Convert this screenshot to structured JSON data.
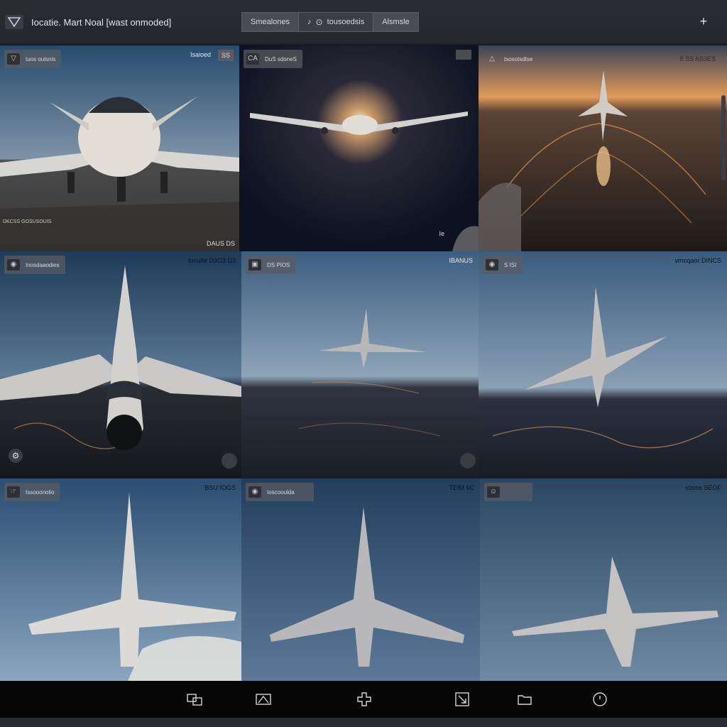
{
  "window": {
    "title": "Iocatie. Mart Noal [wast onmoded]",
    "new_tab_icon": "plus-icon",
    "logo_icon": "triangle-logo-icon"
  },
  "toolbar_tabs": [
    {
      "label": "Smealones"
    },
    {
      "label": "tousoedsis"
    },
    {
      "label": "Alsmsle"
    }
  ],
  "tiles": [
    {
      "chip_label": "tuos oulsnis",
      "tag": "Isaioed",
      "corner": "DAUS DS",
      "footnote": "DKCSS GOSUSOUIS"
    },
    {
      "chip_label": "DuS sdoneS",
      "tag": "",
      "corner": "Ie",
      "footnote": ""
    },
    {
      "chip_label": "tsosotsdtse",
      "tag": "9 SS AS3ES",
      "corner": "",
      "footnote": ""
    },
    {
      "chip_label": "Inosdaaodies",
      "tag": "Ionufle D3G3 D3",
      "corner": "",
      "footnote": ""
    },
    {
      "chip_label": "DS PIOS",
      "tag": "IBANUS",
      "corner": "",
      "footnote": ""
    },
    {
      "chip_label": "S ISI",
      "tag": "vmoqaor DINCS",
      "corner": "",
      "footnote": ""
    },
    {
      "chip_label": "Issooonolio",
      "tag": "'BSU IOGS",
      "corner": "",
      "footnote": ""
    },
    {
      "chip_label": "Ioscooulda",
      "tag": "TEIM 6C",
      "corner": "",
      "footnote": ""
    },
    {
      "chip_label": "",
      "tag": "tosios SEOF",
      "corner": "",
      "footnote": ""
    }
  ],
  "dock_icons": [
    "windows-icon",
    "image-crop-icon",
    "puzzle-icon",
    "export-icon",
    "folder-icon",
    "circle-icon"
  ],
  "colors": {
    "topbar": "#2b2d33",
    "dock": "#060607",
    "sky_day": "#3e6384",
    "sky_night": "#0d1422",
    "sunset": "#e09a59",
    "aircraft": "#c9c8c6"
  }
}
